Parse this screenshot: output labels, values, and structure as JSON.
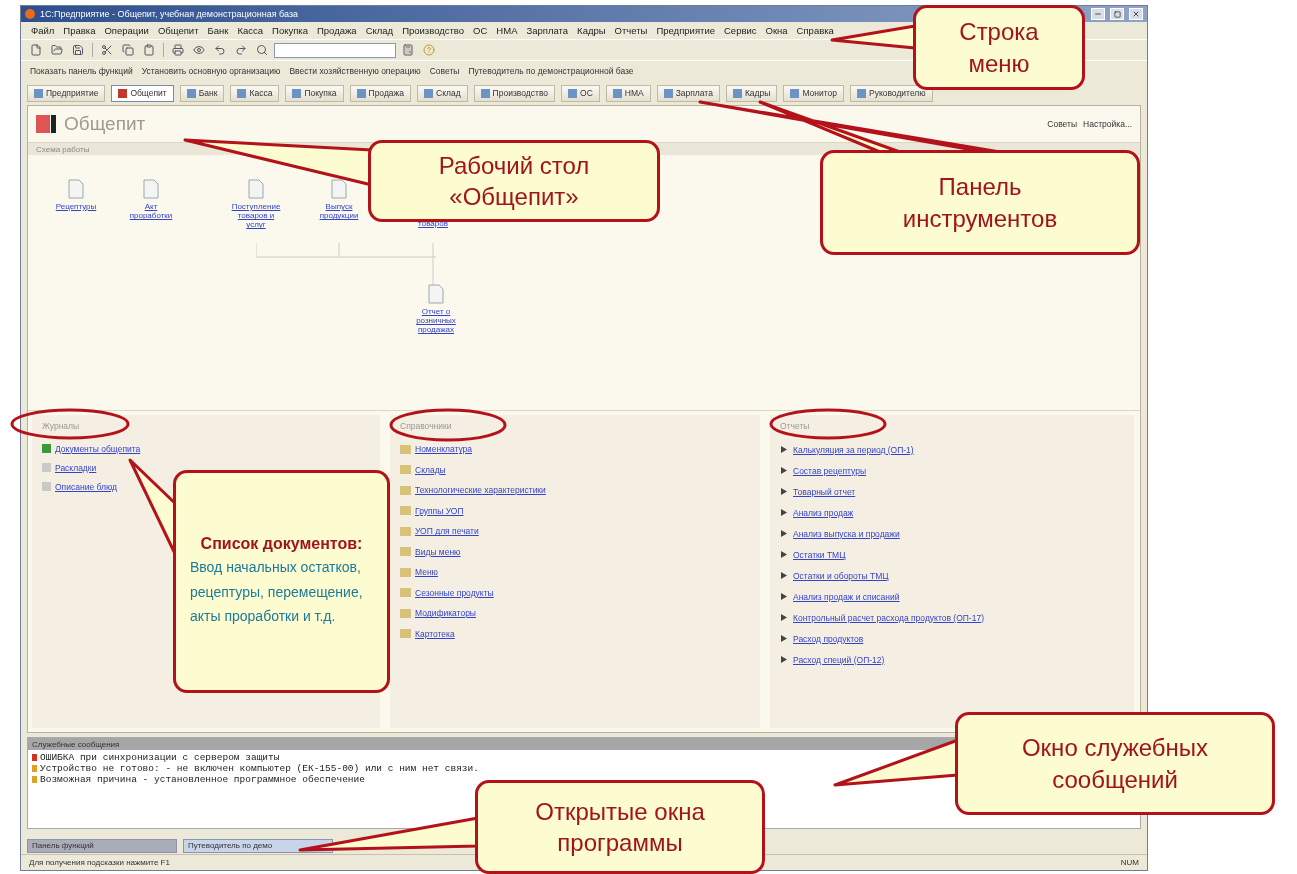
{
  "window": {
    "title": "1С:Предприятие - Общепит, учебная демонстрационная база"
  },
  "menu": [
    "Файл",
    "Правка",
    "Операции",
    "Общепит",
    "Банк",
    "Касса",
    "Покупка",
    "Продажа",
    "Склад",
    "Производство",
    "ОС",
    "НМА",
    "Зарплата",
    "Кадры",
    "Отчеты",
    "Предприятие",
    "Сервис",
    "Окна",
    "Справка"
  ],
  "actions": [
    {
      "label": "Показать панель функций"
    },
    {
      "label": "Установить основную организацию"
    },
    {
      "label": "Ввести хозяйственную операцию"
    },
    {
      "label": "Советы"
    },
    {
      "label": "Путеводитель по демонстрационной базе"
    }
  ],
  "tabs": [
    {
      "label": "Предприятие",
      "selected": false
    },
    {
      "label": "Общепит",
      "selected": true
    },
    {
      "label": "Банк",
      "selected": false
    },
    {
      "label": "Касса",
      "selected": false
    },
    {
      "label": "Покупка",
      "selected": false
    },
    {
      "label": "Продажа",
      "selected": false
    },
    {
      "label": "Склад",
      "selected": false
    },
    {
      "label": "Производство",
      "selected": false
    },
    {
      "label": "ОС",
      "selected": false
    },
    {
      "label": "НМА",
      "selected": false
    },
    {
      "label": "Зарплата",
      "selected": false
    },
    {
      "label": "Кадры",
      "selected": false
    },
    {
      "label": "Монитор",
      "selected": false
    },
    {
      "label": "Руководителю",
      "selected": false
    }
  ],
  "desktop": {
    "title": "Общепит",
    "links": [
      "Советы",
      "Настройка..."
    ],
    "scheme": {
      "title": "Схема работы",
      "nodes": [
        {
          "label": "Рецептуры",
          "kind": "doc"
        },
        {
          "label": "Акт проработки",
          "kind": "doc"
        },
        {
          "label": "Поступление товаров и услуг",
          "kind": "doc"
        },
        {
          "label": "Выпуск продукции",
          "kind": "doc"
        },
        {
          "label": "товаров",
          "kind": "text"
        },
        {
          "label": "Отчет о розничных продажах",
          "kind": "doc"
        }
      ]
    },
    "sections": [
      {
        "title": "Журналы",
        "kind": "journal",
        "items": [
          "Документы общепита",
          "Раскладки",
          "Описание блюд"
        ]
      },
      {
        "title": "Справочники",
        "kind": "catalog",
        "items": [
          "Номенклатура",
          "Склады",
          "Технологические характеристики",
          "Группы УОП",
          "УОП для печати",
          "Виды меню",
          "Меню",
          "Сезонные продукты",
          "Модификаторы",
          "Картотека"
        ]
      },
      {
        "title": "Отчеты",
        "kind": "report",
        "items": [
          "Калькуляция за период (ОП-1)",
          "Состав рецептуры",
          "Товарный отчет",
          "Анализ продаж",
          "Анализ выпуска и продажи",
          "Остатки ТМЦ",
          "Остатки и обороты ТМЦ",
          "Анализ продаж и списаний",
          "Контрольный расчет расхода продуктов (ОП-17)",
          "Расход продуктов",
          "Расход специй (ОП-12)"
        ]
      }
    ]
  },
  "messages": {
    "title": "Служебные сообщения",
    "lines": [
      {
        "kind": "error",
        "text": "ОШИБКА при синхронизации с сервером защиты"
      },
      {
        "kind": "info",
        "text": "Устройство не готово: - не включен компьютер (ЕК-155-00) или с ним нет связи."
      },
      {
        "kind": "info",
        "text": "Возможная причина - установленное программное обеспечение"
      }
    ]
  },
  "taskbar": [
    {
      "label": "Панель функций",
      "selected": false
    },
    {
      "label": "Путеводитель по демо",
      "selected": true
    }
  ],
  "status_bar": {
    "hint": "Для получения подсказки нажмите F1",
    "indicator": "NUM"
  },
  "callouts": [
    {
      "title": "Строка меню"
    },
    {
      "title": "Рабочий стол «Общепит»"
    },
    {
      "title": "Панель инструментов"
    },
    {
      "title": "Список документов:",
      "body": "Ввод начальных остатков, рецептуры, перемещение, акты проработки и т.д."
    },
    {
      "title": "Окно служебных сообщений"
    },
    {
      "title": "Открытые окна программы"
    }
  ]
}
